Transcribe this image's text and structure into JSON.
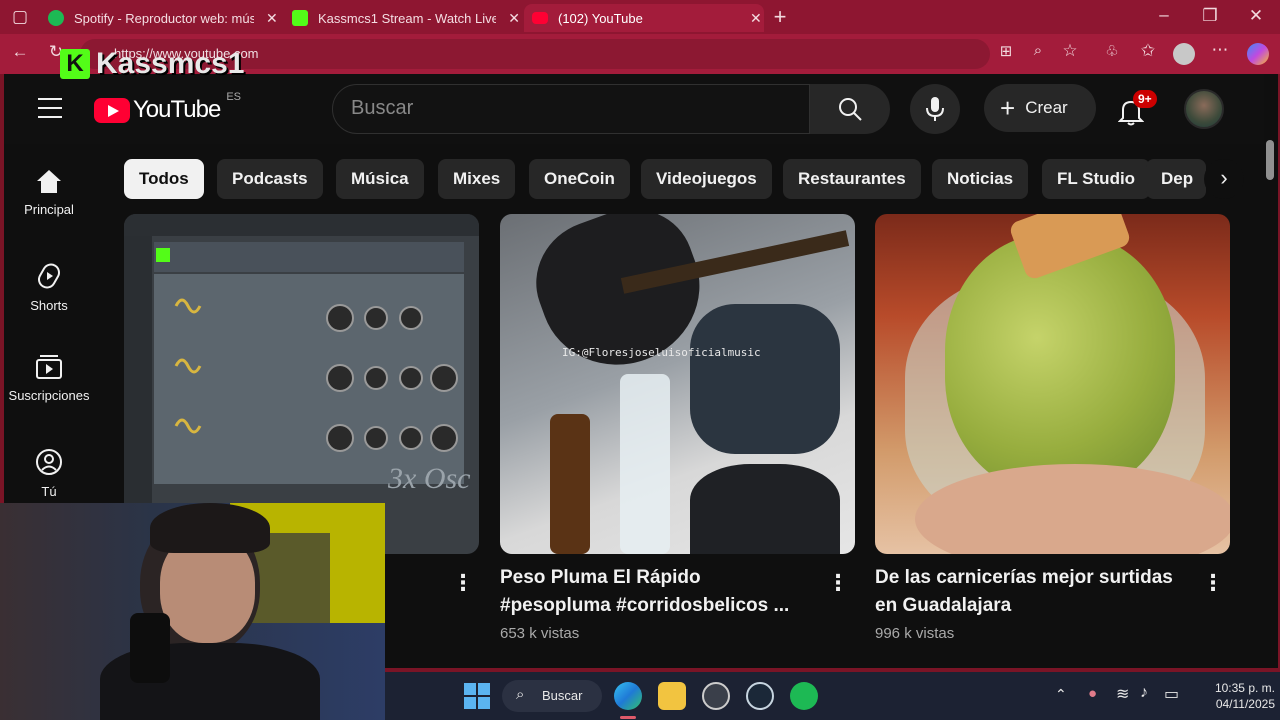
{
  "browser": {
    "tabs": [
      {
        "label": "Spotify - Reproductor web: músic",
        "icon": "spotify-icon",
        "color": "#1db954"
      },
      {
        "label": "Kassmcs1 Stream - Watch Live on",
        "icon": "kick-icon",
        "color": "#53fc18"
      },
      {
        "label": "(102) YouTube",
        "icon": "youtube-icon",
        "color": "#ff0033"
      }
    ],
    "url": "https://www.youtube.com"
  },
  "overlay": {
    "streamer": "Kassmcs1"
  },
  "youtube": {
    "logo_text": "YouTube",
    "country": "ES",
    "search_placeholder": "Buscar",
    "create_label": "Crear",
    "notifications_badge": "9+",
    "nav": [
      {
        "label": "Principal",
        "icon": "home-icon"
      },
      {
        "label": "Shorts",
        "icon": "shorts-icon"
      },
      {
        "label": "Suscripciones",
        "icon": "subscriptions-icon"
      },
      {
        "label": "Tú",
        "icon": "you-icon"
      }
    ],
    "chips": [
      "Todos",
      "Podcasts",
      "Música",
      "Mixes",
      "OneCoin",
      "Videojuegos",
      "Restaurantes",
      "Noticias",
      "FL Studio",
      "Dep"
    ],
    "videos": [
      {
        "title_line1": "",
        "title_line2": "",
        "meta": "",
        "thumb_text": "3x Osc"
      },
      {
        "title_line1": "Peso Pluma El Rápido",
        "title_line2": "#pesopluma #corridosbelicos ...",
        "meta": "653 k vistas",
        "thumb_text": "IG:@Floresjoseluisoficialmusic"
      },
      {
        "title_line1": "De las carnicerías mejor surtidas",
        "title_line2": "en Guadalajara",
        "meta": "996 k vistas",
        "thumb_text": ""
      }
    ]
  },
  "taskbar": {
    "search_label": "Buscar",
    "time": "10:35 p. m.",
    "date": "04/11/2025"
  },
  "colors": {
    "brand_red": "#ff0033",
    "chrome": "#a31c3b"
  }
}
